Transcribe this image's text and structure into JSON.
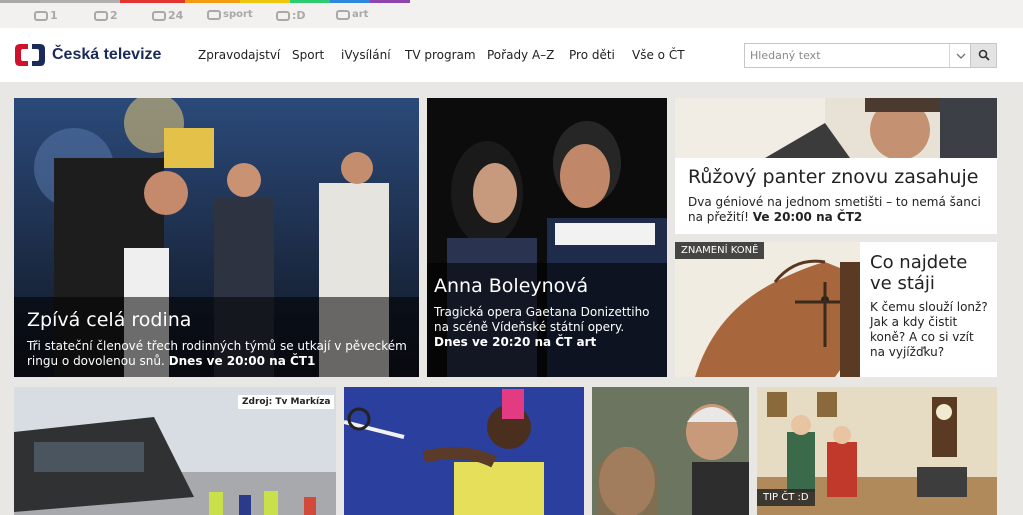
{
  "channel_bar": {
    "stripe_colors": [
      "#a8a8a8",
      "#b0b0b0",
      "#e3342f",
      "#f39c12",
      "#f1c40f",
      "#2ecc71",
      "#2e86de",
      "#8e44ad"
    ],
    "channels": [
      {
        "label": "1",
        "icon": "ct1-logo-icon"
      },
      {
        "label": "2",
        "icon": "ct2-logo-icon"
      },
      {
        "label": "24",
        "icon": "ct24-logo-icon"
      },
      {
        "label": "sport",
        "icon": "ctsport-logo-icon"
      },
      {
        "label": ":D",
        "icon": "ctd-logo-icon"
      },
      {
        "label": "art",
        "icon": "ctart-logo-icon"
      }
    ]
  },
  "header": {
    "brand": "Česká televize",
    "brand_colors": {
      "red": "#d0112b",
      "blue": "#1a2a5a"
    },
    "nav": [
      "Zpravodajství",
      "Sport",
      "iVysílání",
      "TV program",
      "Pořady A–Z",
      "Pro děti",
      "Vše o ČT"
    ],
    "search": {
      "placeholder": "Hledaný text",
      "value": "",
      "dropdown_icon": "chevron-down-icon",
      "button_icon": "search-icon"
    }
  },
  "tiles": {
    "main": {
      "title": "Zpívá celá rodina",
      "desc": "Tři stateční členové třech rodinných týmů se utkají v pěveckém ringu o dovolenou snů.",
      "time": "Dnes ve 20:00 na ČT1"
    },
    "opera": {
      "title": "Anna Boleynová",
      "desc": "Tragická opera Gaetana Donizettiho na scéně Vídeňské státní opery.",
      "time": "Dnes ve 20:20 na ČT art"
    },
    "panther": {
      "title": "Růžový panter znovu zasahuje",
      "desc": "Dva géniové na jednom smetišti – to nemá šanci na přežití!",
      "time": "Ve 20:00 na ČT2"
    },
    "horse": {
      "tag": "ZNAMENÍ KONĚ",
      "title": "Co najdete ve stáji",
      "desc": "K čemu slouží lonž? Jak a kdy čistit koně? A co si vzít na vyjížďku?"
    },
    "news": {
      "source": "Zdroj: Tv Markíza"
    },
    "kids": {
      "tag": "TIP ČT :D"
    }
  }
}
